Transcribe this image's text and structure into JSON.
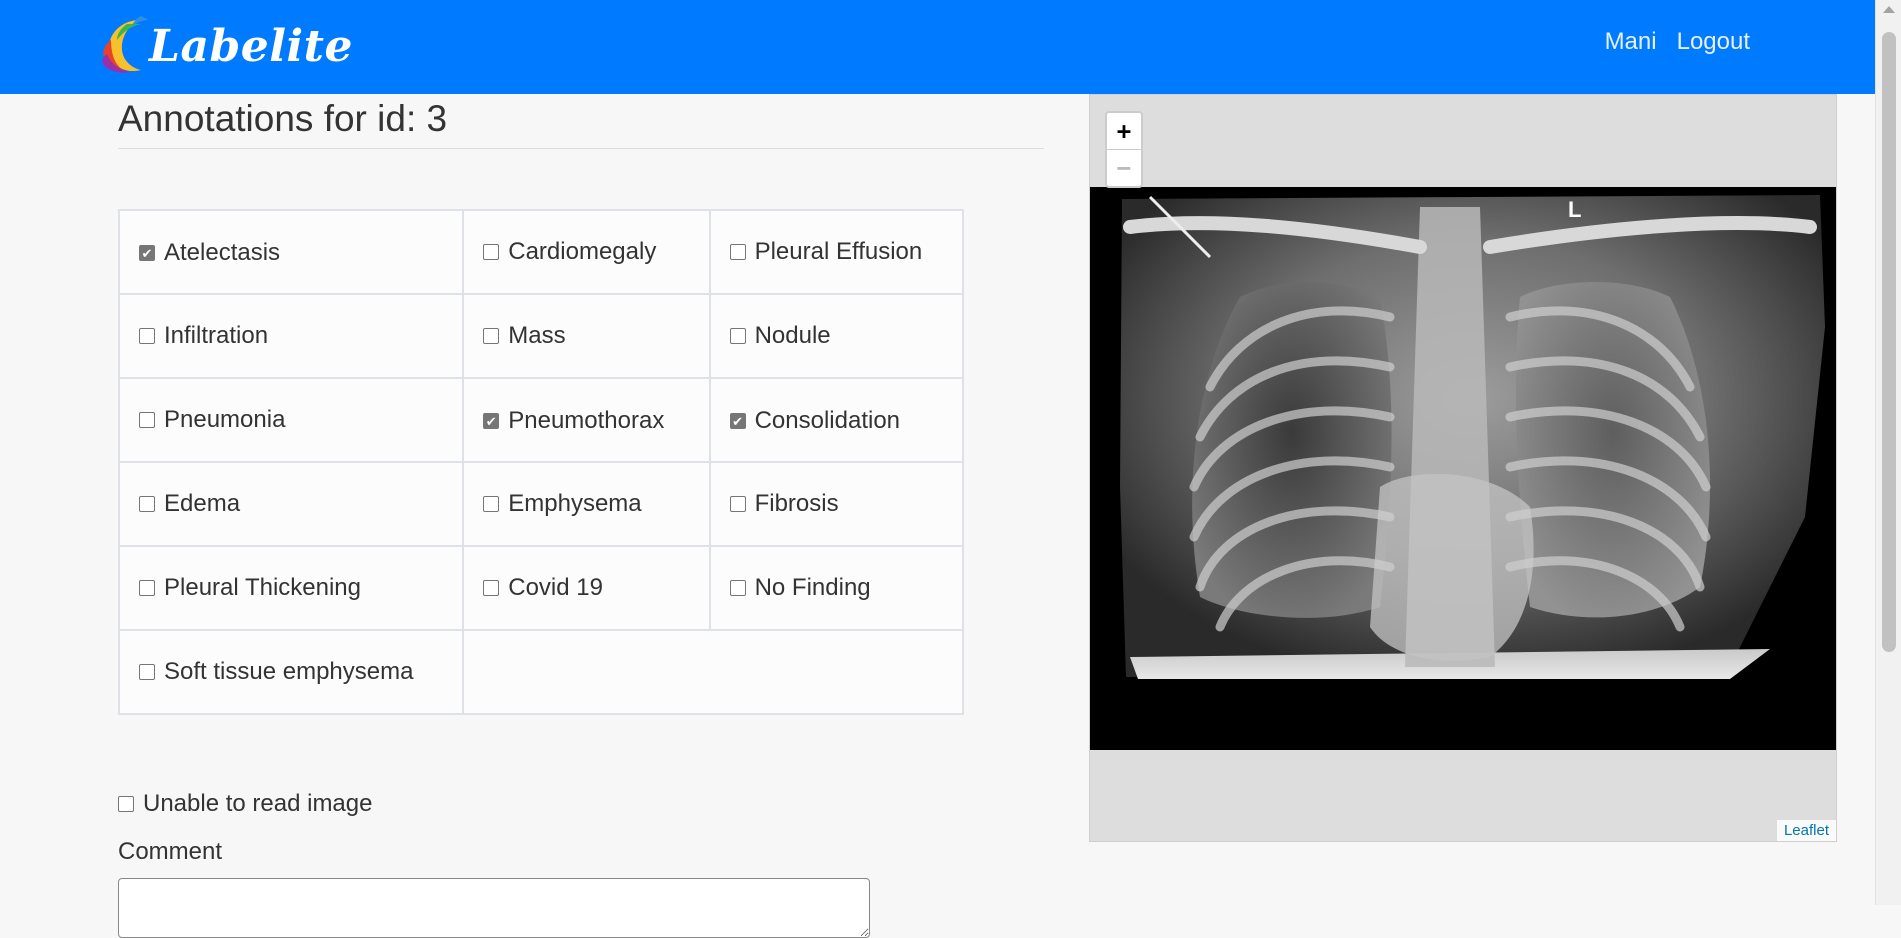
{
  "app": {
    "brand": "Labelite"
  },
  "nav": {
    "user": "Mani",
    "logout": "Logout"
  },
  "page": {
    "title": "Annotations for id: 3"
  },
  "labels": [
    {
      "label": "Atelectasis",
      "checked": true
    },
    {
      "label": "Cardiomegaly",
      "checked": false
    },
    {
      "label": "Pleural Effusion",
      "checked": false
    },
    {
      "label": "Infiltration",
      "checked": false
    },
    {
      "label": "Mass",
      "checked": false
    },
    {
      "label": "Nodule",
      "checked": false
    },
    {
      "label": "Pneumonia",
      "checked": false
    },
    {
      "label": "Pneumothorax",
      "checked": true
    },
    {
      "label": "Consolidation",
      "checked": true
    },
    {
      "label": "Edema",
      "checked": false
    },
    {
      "label": "Emphysema",
      "checked": false
    },
    {
      "label": "Fibrosis",
      "checked": false
    },
    {
      "label": "Pleural Thickening",
      "checked": false
    },
    {
      "label": "Covid 19",
      "checked": false
    },
    {
      "label": "No Finding",
      "checked": false
    },
    {
      "label": "Soft tissue emphysema",
      "checked": false
    }
  ],
  "form": {
    "unable_label": "Unable to read image",
    "unable_checked": false,
    "comment_label": "Comment",
    "comment_value": ""
  },
  "viewer": {
    "zoom_in": "+",
    "zoom_out": "−",
    "attribution": "Leaflet",
    "image_marker": "L"
  },
  "colors": {
    "navbar": "#007bff",
    "background": "#f7f7f7",
    "viewer_bg": "#dddddd"
  }
}
